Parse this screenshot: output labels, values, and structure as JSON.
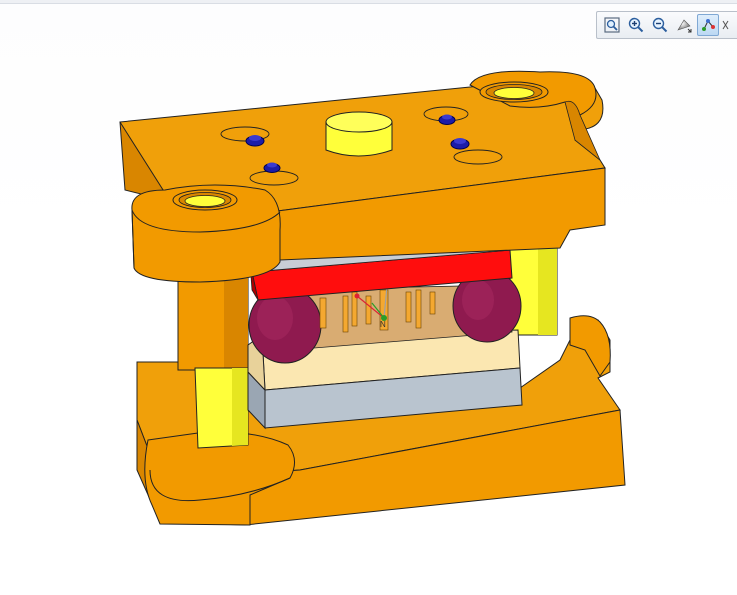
{
  "window": {
    "title": ""
  },
  "toolbar": {
    "buttons": [
      {
        "name": "refit-button",
        "icon": "refit-icon"
      },
      {
        "name": "zoom-in-button",
        "icon": "zoom-in-icon"
      },
      {
        "name": "zoom-out-button",
        "icon": "zoom-out-icon"
      },
      {
        "name": "display-style-button",
        "icon": "display-style-icon"
      },
      {
        "name": "datum-display-button",
        "icon": "datum-display-icon",
        "active": true
      }
    ]
  },
  "model": {
    "description_colors": {
      "plate_orange": "#f29a00",
      "plate_orange_dark": "#d07f00",
      "guide_yellow": "#ffff33",
      "red_plate": "#ff0d0d",
      "rubber_maroon": "#8f1a4f",
      "die_cream": "#fbe7b1",
      "die_grey": "#b9c4cf",
      "screw_blue": "#1c1ca8"
    },
    "csys_label": "N"
  }
}
